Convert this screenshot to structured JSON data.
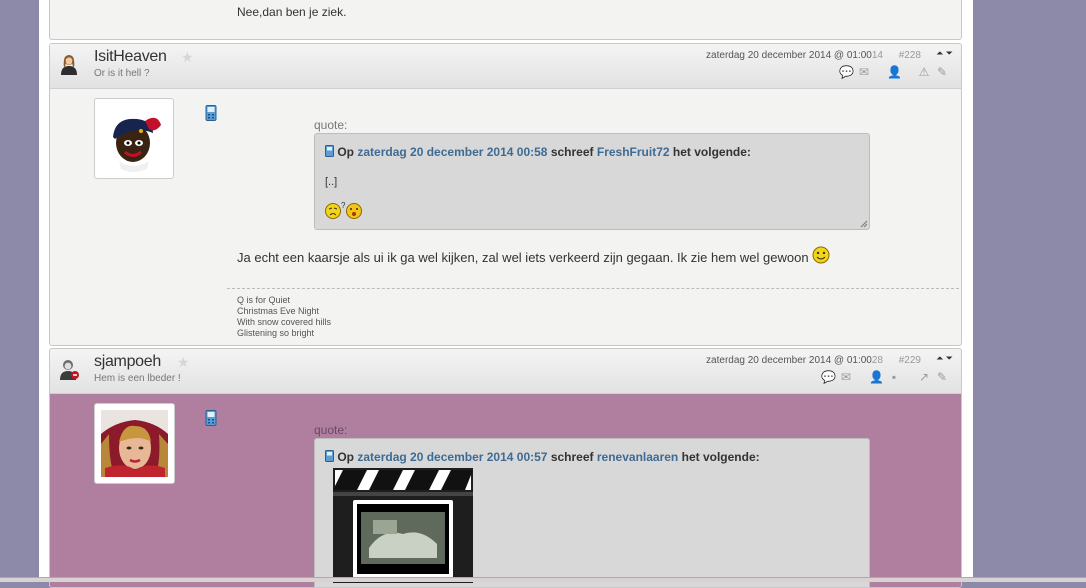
{
  "previous_post": {
    "text": "Nee,dan ben je ziek."
  },
  "posts": [
    {
      "username": "IsitHeaven",
      "user_title": "Or is it hell ?",
      "date": "zaterdag 20 december 2014 @ 01:00",
      "seconds": "14",
      "post_number": "#228",
      "quote": {
        "label": "quote:",
        "prefix": "Op",
        "date_link": "zaterdag 20 december 2014 00:58",
        "middle": "schreef",
        "author_link": "FreshFruit72",
        "suffix": "het volgende:",
        "body": "[..]"
      },
      "message": "Ja echt een kaarsje als ui ik ga wel kijken, zal wel iets verkeerd zijn gegaan. Ik zie hem wel gewoon",
      "signature": [
        "Q is for Quiet",
        "Christmas Eve Night",
        "With snow covered hills",
        "Glistening so bright"
      ]
    },
    {
      "username": "sjampoeh",
      "user_title": "Hem is een lbeder !",
      "date": "zaterdag 20 december 2014 @ 01:00",
      "seconds": "28",
      "post_number": "#229",
      "quote": {
        "label": "quote:",
        "prefix": "Op",
        "date_link": "zaterdag 20 december 2014 00:57",
        "middle": "schreef",
        "author_link": "renevanlaaren",
        "suffix": "het volgende:"
      }
    }
  ],
  "colors": {
    "page_bg": "#8c8aa8",
    "highlight_post_bg": "#b07fa0",
    "link": "#3e6b93",
    "quote_bg": "#d8d8d8"
  },
  "icons": [
    "user-female-icon",
    "user-mod-icon",
    "star-icon",
    "phone-icon",
    "quote-icon",
    "mail-icon",
    "profile-icon",
    "report-icon",
    "edit-icon",
    "nav-up-icon",
    "nav-down-icon",
    "smiley-icon"
  ]
}
